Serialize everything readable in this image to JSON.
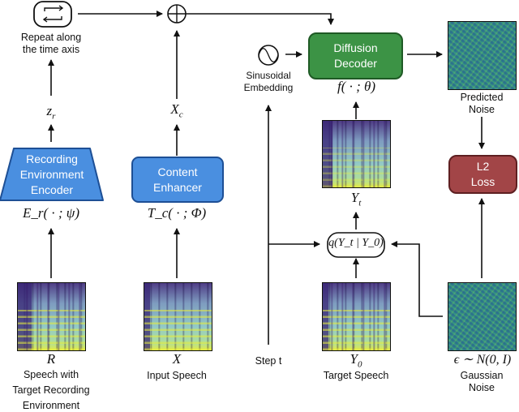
{
  "diagram": {
    "top": {
      "repeat_icon": "repeat-arrows-icon",
      "repeat_label_line1": "Repeat along",
      "repeat_label_line2": "the time axis",
      "sum_icon": "circled-plus-icon"
    },
    "latents": {
      "z_r": "z_r",
      "x_c": "X_c"
    },
    "encoder": {
      "label_line1": "Recording",
      "label_line2": "Environment",
      "label_line3": "Encoder",
      "func": "E_r( · ; ψ)",
      "color": "#4a8fe0"
    },
    "enhancer": {
      "label_line1": "Content",
      "label_line2": "Enhancer",
      "func": "T_c( · ; Φ)",
      "color": "#4a8fe0"
    },
    "decoder": {
      "label_line1": "Diffusion",
      "label_line2": "Decoder",
      "func": "f( · ; θ)",
      "color": "#3c9345"
    },
    "sinusoidal": {
      "icon": "sine-wave-icon",
      "label_line1": "Sinusoidal",
      "label_line2": "Embedding"
    },
    "predicted_noise": {
      "label_line1": "Predicted",
      "label_line2": "Noise"
    },
    "loss": {
      "label_line1": "L2",
      "label_line2": "Loss",
      "color": "#a24547"
    },
    "yt": {
      "symbol": "Y_t"
    },
    "q_node": {
      "label": "q(Y_t | Y_0)"
    },
    "inputs": {
      "r_symbol": "R",
      "r_label_line1": "Speech with",
      "r_label_line2": "Target Recording",
      "r_label_line3": "Environment",
      "x_symbol": "X",
      "x_label": "Input Speech",
      "step_label": "Step t",
      "y0_symbol": "Y_0",
      "y0_label": "Target Speech",
      "eps_symbol": "ϵ ∼ N(0, I)",
      "eps_label_line1": "Gaussian",
      "eps_label_line2": "Noise"
    }
  }
}
